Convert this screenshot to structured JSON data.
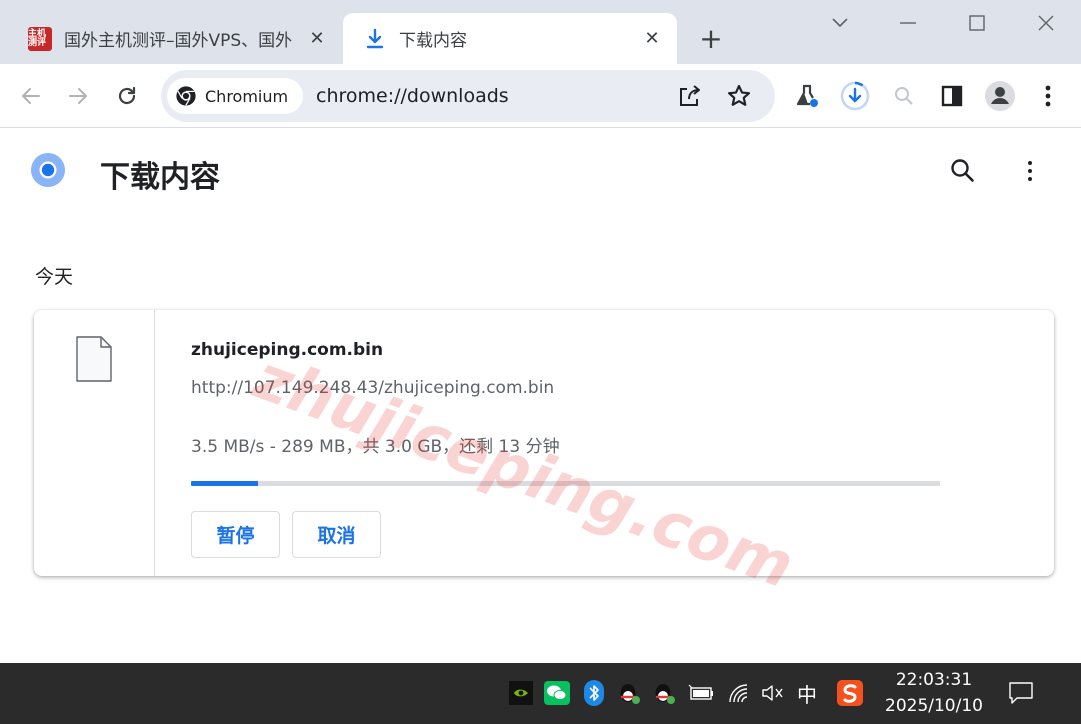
{
  "tabs": [
    {
      "title": "国外主机测评–国外VPS、国外",
      "favicon_text": "主机测评",
      "active": false
    },
    {
      "title": "下载内容",
      "active": true
    }
  ],
  "toolbar": {
    "chip_label": "Chromium",
    "url": "chrome://downloads"
  },
  "page": {
    "title": "下载内容",
    "date_header": "今天"
  },
  "download": {
    "file_name": "zhujiceping.com.bin",
    "url": "http://107.149.248.43/zhujiceping.com.bin",
    "status": "3.5 MB/s - 289 MB，共 3.0 GB，还剩 13 分钟",
    "progress_fraction": 0.09,
    "pause_label": "暂停",
    "cancel_label": "取消"
  },
  "watermark": "zhujiceping.com",
  "taskbar": {
    "ime_label": "中",
    "time": "22:03:31",
    "date": "2025/10/10"
  },
  "colors": {
    "accent": "#1a73e8",
    "tabstrip": "#dee3eb",
    "taskbar": "#2b2b2b"
  }
}
